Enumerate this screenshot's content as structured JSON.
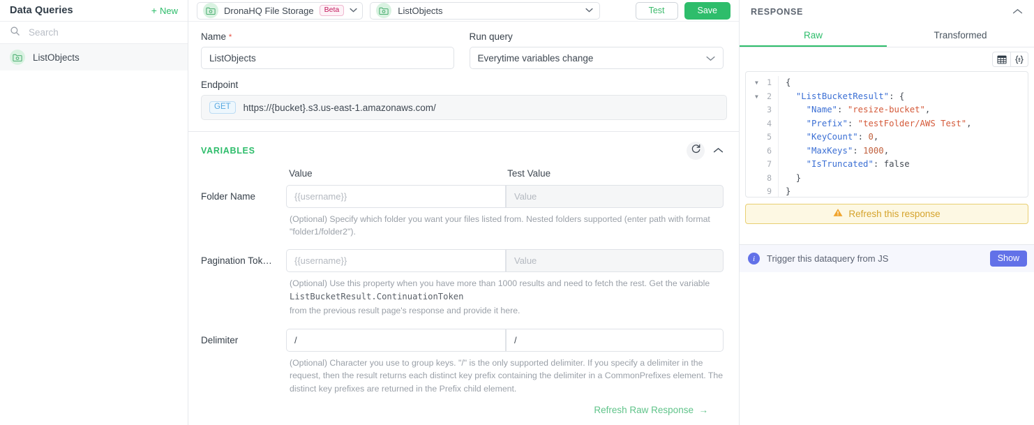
{
  "sidebar": {
    "title": "Data Queries",
    "new_label": "New",
    "search_placeholder": "Search",
    "search_value": "",
    "items": [
      {
        "label": "ListObjects",
        "icon": "folder-image-icon"
      }
    ]
  },
  "topbar": {
    "connection": {
      "name": "DronaHQ File Storage",
      "badge": "Beta",
      "icon": "folder-image-icon"
    },
    "operation": {
      "name": "ListObjects",
      "icon": "folder-image-icon"
    },
    "test_label": "Test",
    "save_label": "Save"
  },
  "form": {
    "name_label": "Name",
    "name_required_marker": "*",
    "name_value": "ListObjects",
    "run_query_label": "Run query",
    "run_query_value": "Everytime variables change",
    "endpoint_label": "Endpoint",
    "endpoint_method": "GET",
    "endpoint_url": "https://{bucket}.s3.us-east-1.amazonaws.com/"
  },
  "variables": {
    "section_title": "VARIABLES",
    "col_value": "Value",
    "col_test_value": "Test Value",
    "rows": [
      {
        "label": "Folder Name",
        "value": "",
        "value_placeholder": "{{username}}",
        "test_value": "",
        "test_placeholder": "Value",
        "help_prefix": "(Optional) Specify which folder you want your files listed from. Nested folders supported (enter path with format \"folder1/folder2\").",
        "help_mono": "",
        "help_suffix": ""
      },
      {
        "label": "Pagination Tok…",
        "value": "",
        "value_placeholder": "{{username}}",
        "test_value": "",
        "test_placeholder": "Value",
        "help_prefix": "(Optional) Use this property when you have more than 1000 results and need to fetch the rest. Get the variable",
        "help_mono": "ListBucketResult.ContinuationToken",
        "help_suffix": "from the previous result page's response and provide it here."
      },
      {
        "label": "Delimiter",
        "value": "/",
        "value_placeholder": "",
        "test_value": "/",
        "test_placeholder": "",
        "help_prefix": "(Optional) Character you use to group keys. \"/\" is the only supported delimiter. If you specify a delimiter in the request, then the result returns each distinct key prefix containing the delimiter in a CommonPrefixes element. The distinct key prefixes are returned in the Prefix child element.",
        "help_mono": "",
        "help_suffix": ""
      }
    ],
    "refresh_raw_label": "Refresh Raw Response"
  },
  "response": {
    "title": "RESPONSE",
    "tabs": [
      {
        "label": "Raw",
        "active": true
      },
      {
        "label": "Transformed",
        "active": false
      }
    ],
    "view_table_icon": "table-view-icon",
    "view_json_icon": "json-view-icon",
    "code_lines": [
      {
        "num": "1",
        "fold": true,
        "text": "{"
      },
      {
        "num": "2",
        "fold": true,
        "text": "  \"ListBucketResult\": {"
      },
      {
        "num": "3",
        "fold": false,
        "text": "    \"Name\": \"resize-bucket\","
      },
      {
        "num": "4",
        "fold": false,
        "text": "    \"Prefix\": \"testFolder/AWS Test\","
      },
      {
        "num": "5",
        "fold": false,
        "text": "    \"KeyCount\": 0,"
      },
      {
        "num": "6",
        "fold": false,
        "text": "    \"MaxKeys\": 1000,"
      },
      {
        "num": "7",
        "fold": false,
        "text": "    \"IsTruncated\": false"
      },
      {
        "num": "8",
        "fold": false,
        "text": "  }"
      },
      {
        "num": "9",
        "fold": false,
        "text": "}"
      }
    ],
    "response_json": {
      "ListBucketResult": {
        "Name": "resize-bucket",
        "Prefix": "testFolder/AWS Test",
        "KeyCount": 0,
        "MaxKeys": 1000,
        "IsTruncated": false
      }
    },
    "warning_label": "Refresh this response",
    "info_label": "Trigger this dataquery from JS",
    "info_button": "Show"
  },
  "colors": {
    "accent_green": "#2ebd6b",
    "beta_pink": "#c2185b",
    "warning_yellow": "#d5a32c",
    "info_purple": "#6271e8",
    "required_red": "#e8574a"
  }
}
